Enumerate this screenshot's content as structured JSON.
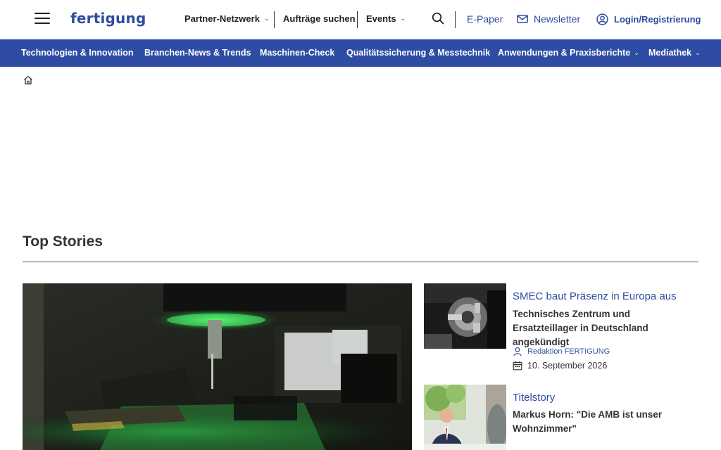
{
  "header": {
    "logo": "fertigung",
    "nav": [
      {
        "label": "Partner-Netzwerk",
        "has_dropdown": true
      },
      {
        "label": "Aufträge suchen",
        "has_dropdown": false
      },
      {
        "label": "Events",
        "has_dropdown": true
      }
    ],
    "epaper": "E-Paper",
    "newsletter": "Newsletter",
    "login": "Login/Registrierung"
  },
  "categories": [
    {
      "label": "Technologien & Innovation"
    },
    {
      "label": "Branchen-News & Trends"
    },
    {
      "label": "Maschinen-Check"
    },
    {
      "label": "Qualitätssicherung & Messtechnik"
    },
    {
      "label": "Anwendungen & Praxisberichte"
    },
    {
      "label": "Mediathek"
    }
  ],
  "top_stories": {
    "title": "Top Stories",
    "items": [
      {
        "kicker": "SMEC baut Präsenz in Europa aus",
        "title": "Technisches Zentrum und Ersatzteillager in Deutschland angekündigt",
        "author": "Redaktion FERTIGUNG",
        "date": "10. September 2026"
      },
      {
        "kicker": "Titelstory",
        "title": "Markus Horn: \"Die AMB ist unser Wohnzimmer\""
      }
    ]
  },
  "colors": {
    "brand_blue": "#2f4ca4",
    "link_blue": "#2d4da0",
    "text_dark": "#333333"
  }
}
